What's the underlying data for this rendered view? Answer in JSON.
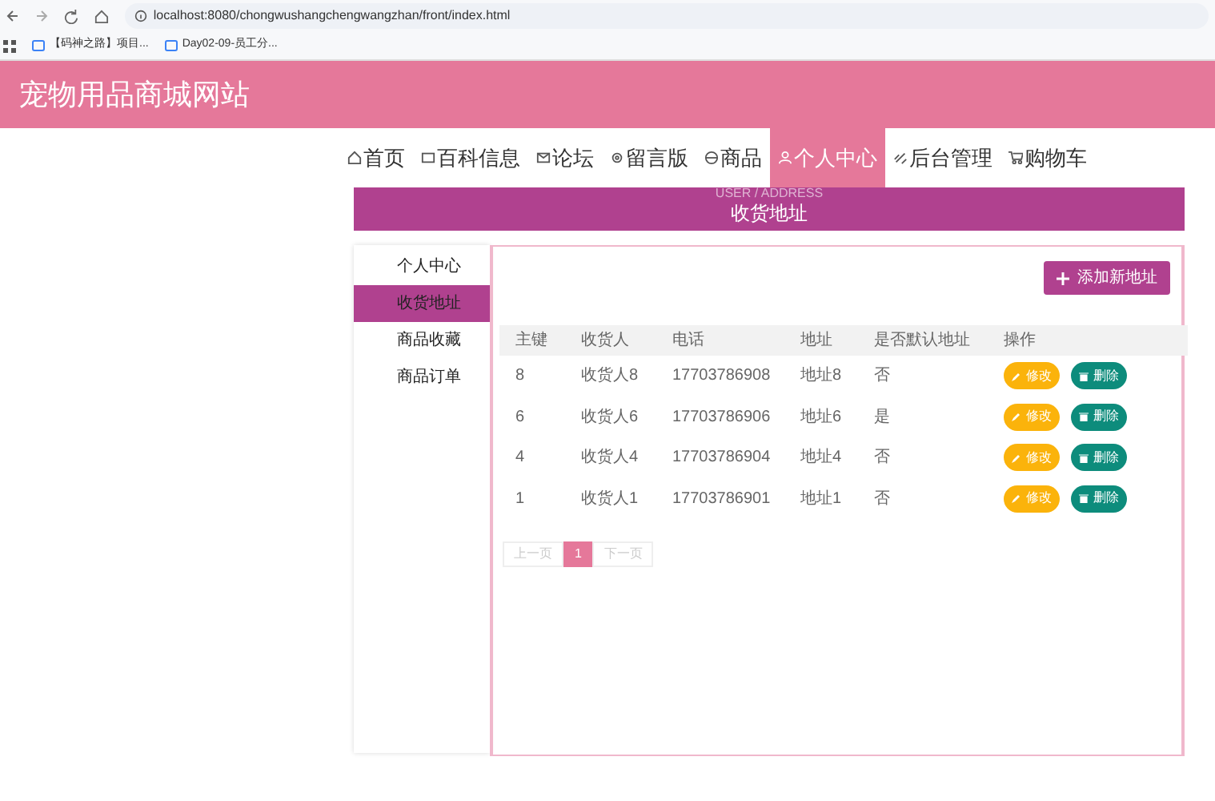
{
  "browser": {
    "url": "localhost:8080/chongwushangchengwangzhan/front/index.html",
    "bookmarks": [
      "【码神之路】项目...",
      "Day02-09-员工分..."
    ]
  },
  "site_title": "宠物用品商城网站",
  "nav": [
    {
      "label": "首页",
      "selected": false
    },
    {
      "label": "百科信息",
      "selected": false
    },
    {
      "label": "论坛",
      "selected": false
    },
    {
      "label": "留言版",
      "selected": false
    },
    {
      "label": "商品",
      "selected": false
    },
    {
      "label": "个人中心",
      "selected": true
    },
    {
      "label": "后台管理",
      "selected": false
    },
    {
      "label": "购物车",
      "selected": false
    }
  ],
  "banner": {
    "subtitle": "USER / ADDRESS",
    "title": "收货地址"
  },
  "sidebar": [
    {
      "label": "个人中心",
      "selected": false
    },
    {
      "label": "收货地址",
      "selected": true
    },
    {
      "label": "商品收藏",
      "selected": false
    },
    {
      "label": "商品订单",
      "selected": false
    }
  ],
  "add_button": "添加新地址",
  "table": {
    "columns": [
      "主键",
      "收货人",
      "电话",
      "地址",
      "是否默认地址",
      "操作"
    ],
    "rows": [
      {
        "cells": [
          "8",
          "收货人8",
          "17703786908",
          "地址8",
          "否"
        ],
        "edit": "修改",
        "delete": "删除"
      },
      {
        "cells": [
          "6",
          "收货人6",
          "17703786906",
          "地址6",
          "是"
        ],
        "edit": "修改",
        "delete": "删除"
      },
      {
        "cells": [
          "4",
          "收货人4",
          "17703786904",
          "地址4",
          "否"
        ],
        "edit": "修改",
        "delete": "删除"
      },
      {
        "cells": [
          "1",
          "收货人1",
          "17703786901",
          "地址1",
          "否"
        ],
        "edit": "修改",
        "delete": "删除"
      }
    ]
  },
  "pagination": [
    {
      "label": "上一页",
      "selected": false
    },
    {
      "label": "1",
      "selected": true
    },
    {
      "label": "下一页",
      "selected": false
    }
  ]
}
